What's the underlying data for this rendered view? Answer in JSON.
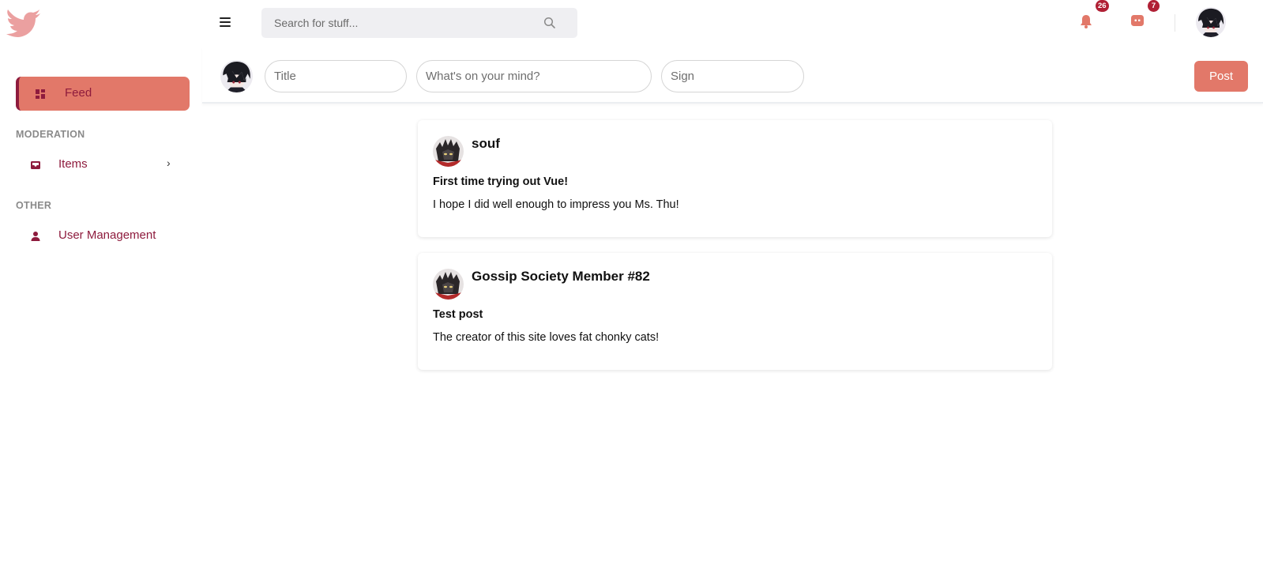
{
  "brand": {
    "logo_icon": "bird-icon",
    "accent": "#e27869",
    "accent_dark": "#8e1b3d"
  },
  "sidebar": {
    "feed": {
      "label": "Feed",
      "icon": "dashboard-icon"
    },
    "sections": [
      {
        "heading": "MODERATION",
        "items": [
          {
            "label": "Items",
            "icon": "inbox-icon",
            "has_submenu": true
          }
        ]
      },
      {
        "heading": "OTHER",
        "items": [
          {
            "label": "User Management",
            "icon": "user-icon"
          }
        ]
      }
    ]
  },
  "header": {
    "search": {
      "placeholder": "Search for stuff..."
    },
    "notifications": {
      "count": "26",
      "icon": "bell-icon"
    },
    "messages": {
      "count": "7",
      "icon": "chat-icon"
    }
  },
  "composer": {
    "title_placeholder": "Title",
    "body_placeholder": "What's on your mind?",
    "sign_placeholder": "Sign",
    "post_label": "Post"
  },
  "posts": [
    {
      "author": "souf",
      "title": "First time trying out Vue!",
      "body": "I hope I did well enough to impress you Ms. Thu!"
    },
    {
      "author": "Gossip Society Member #82",
      "title": "Test post",
      "body": "The creator of this site loves fat chonky cats!"
    }
  ]
}
